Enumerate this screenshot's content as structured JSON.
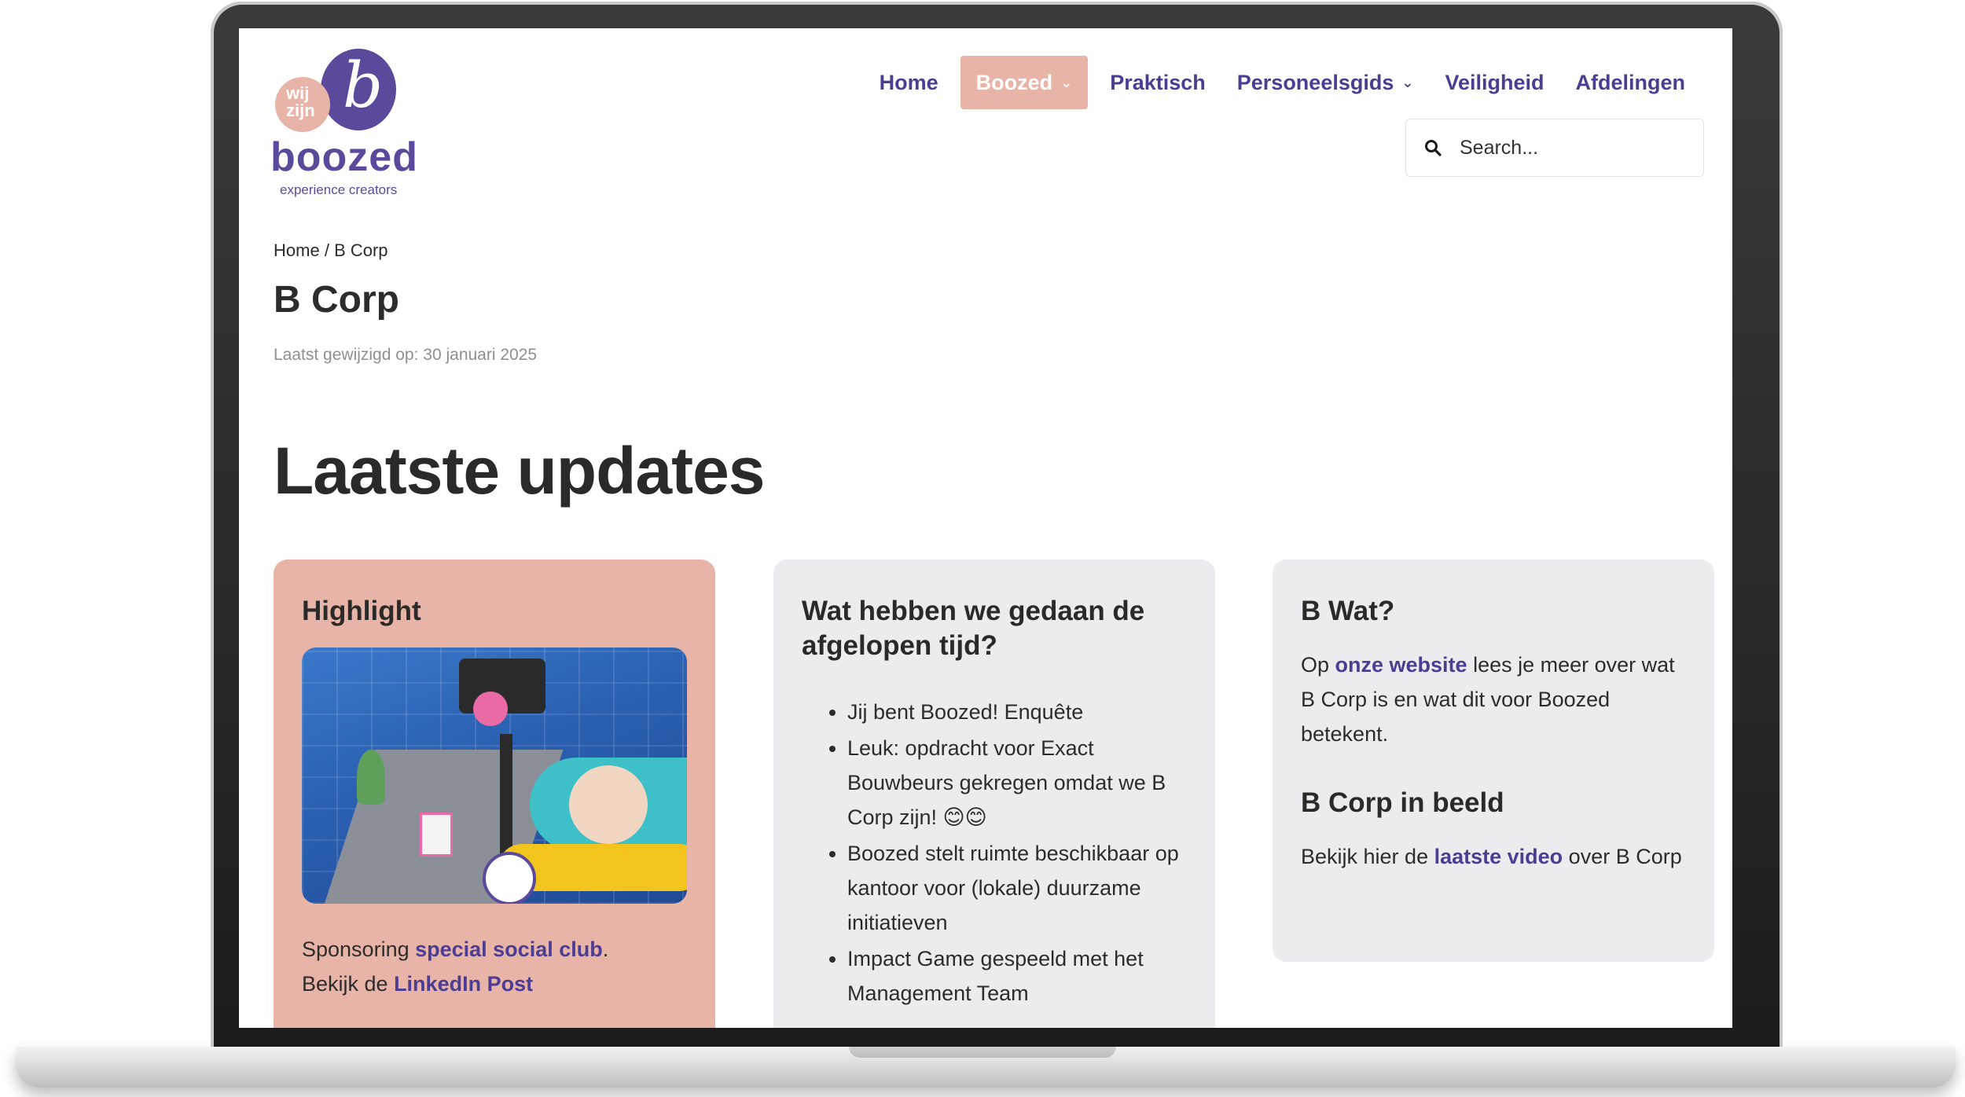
{
  "logo": {
    "wij_zijn": "wij zijn",
    "mark": "b",
    "wordmark": "boozed",
    "tagline": "experience creators"
  },
  "nav": {
    "items": [
      {
        "label": "Home"
      },
      {
        "label": "Boozed",
        "active": true,
        "has_dropdown": true
      },
      {
        "label": "Praktisch"
      },
      {
        "label": "Personeelsgids",
        "has_dropdown": true
      },
      {
        "label": "Veiligheid"
      },
      {
        "label": "Afdelingen"
      }
    ],
    "chevron": "⌄"
  },
  "search": {
    "placeholder": "Search...",
    "icon": "search-icon"
  },
  "breadcrumb": {
    "home": "Home",
    "separator": "/",
    "current": "B Corp"
  },
  "page": {
    "title": "B Corp",
    "last_modified": "Laatst gewijzigd op: 30 januari 2025",
    "section_title": "Laatste updates"
  },
  "cards": {
    "highlight": {
      "title": "Highlight",
      "text_before": "Sponsoring ",
      "link1": "special social club",
      "text_mid": ".",
      "text_line2": "Bekijk de ",
      "link2": "LinkedIn Post"
    },
    "updates": {
      "title": "Wat hebben we gedaan de afgelopen tijd?",
      "items": [
        "Jij bent Boozed! Enquête",
        "Leuk: opdracht voor Exact Bouwbeurs gekregen omdat we B Corp zijn! 😊😊",
        "Boozed stelt ruimte beschikbaar op kantoor voor (lokale) duurzame initiatieven",
        "Impact Game gespeeld met het Management Team"
      ]
    },
    "bwat": {
      "title": "B Wat?",
      "text1_before": "Op ",
      "link1": "onze website",
      "text1_after": " lees je meer over wat B Corp is en wat dit voor Boozed betekent.",
      "title2": "B Corp in beeld",
      "text2_before": "Bekijk hier de ",
      "link2": "laatste video",
      "text2_after": " over B Corp"
    }
  },
  "colors": {
    "brand_purple": "#4b3d92",
    "brand_pink": "#e8b4a8",
    "card_grey": "#ececee"
  }
}
